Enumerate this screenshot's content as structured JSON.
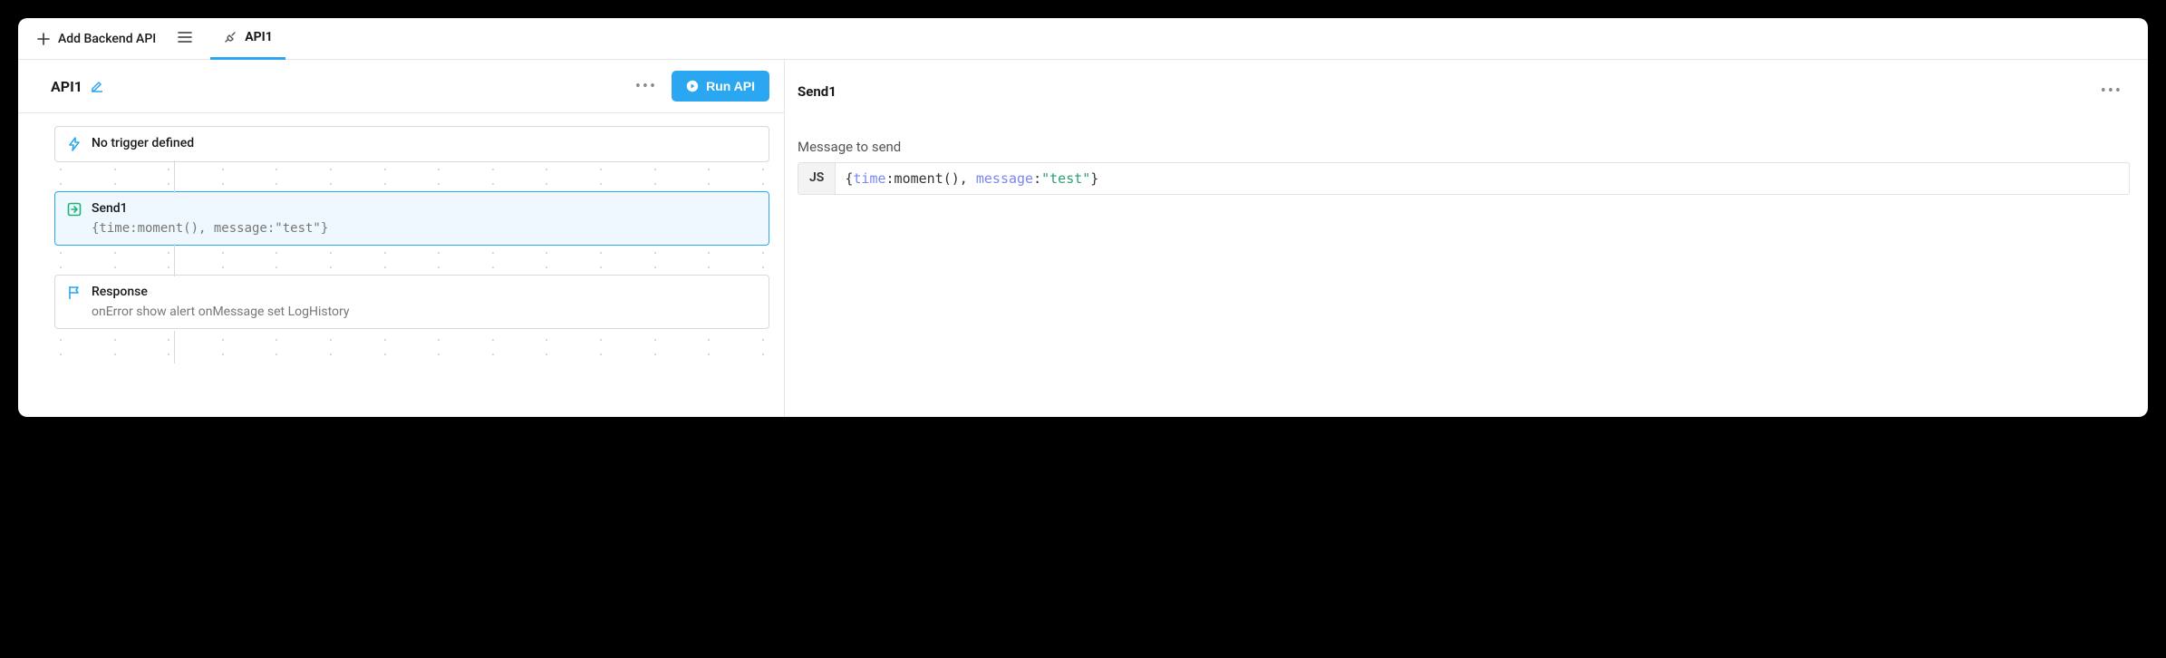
{
  "toolbar": {
    "add_label": "Add Backend API",
    "tab_label": "API1"
  },
  "left": {
    "title": "API1",
    "run_label": "Run API",
    "trigger": {
      "title": "No trigger defined"
    },
    "send": {
      "title": "Send1",
      "code": "{time:moment(), message:\"test\"}"
    },
    "response": {
      "title": "Response",
      "subtitle": "onError show alert onMessage set LogHistory"
    }
  },
  "right": {
    "title": "Send1",
    "field_label": "Message to send",
    "badge": "JS",
    "code_tokens": [
      {
        "t": "punct",
        "v": "{"
      },
      {
        "t": "key",
        "v": "time"
      },
      {
        "t": "punct",
        "v": ":"
      },
      {
        "t": "fn",
        "v": "moment"
      },
      {
        "t": "punct",
        "v": "(), "
      },
      {
        "t": "key",
        "v": "message"
      },
      {
        "t": "punct",
        "v": ":"
      },
      {
        "t": "str",
        "v": "\"test\""
      },
      {
        "t": "punct",
        "v": "}"
      }
    ]
  }
}
